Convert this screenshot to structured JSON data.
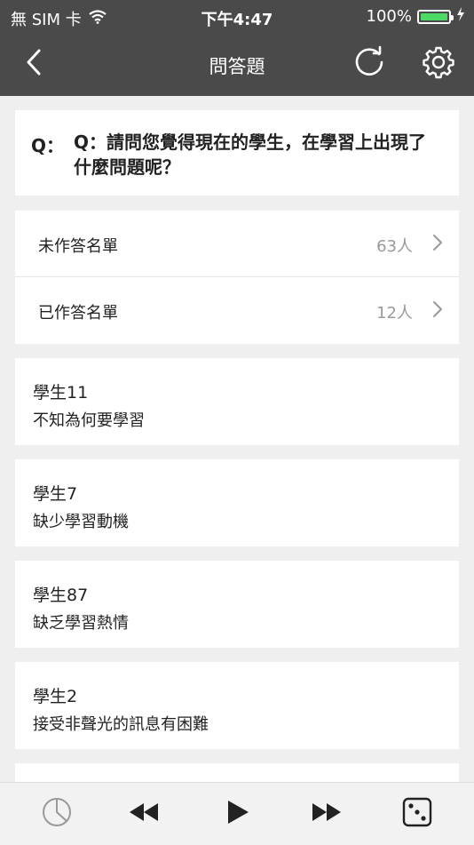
{
  "status": {
    "carrier": "無 SIM 卡",
    "time": "下午4:47",
    "battery": "100%"
  },
  "nav": {
    "title": "問答題",
    "back_icon": "chevron-left-icon",
    "refresh_icon": "refresh-icon",
    "settings_icon": "gear-icon"
  },
  "question": {
    "label": "Q：",
    "text": "Q：請問您覺得現在的學生，在學習上出現了什麼問題呢？"
  },
  "lists": [
    {
      "label": "未作答名單",
      "count": "63人"
    },
    {
      "label": "已作答名單",
      "count": "12人"
    }
  ],
  "answers": [
    {
      "name": "學生11",
      "text": "不知為何要學習"
    },
    {
      "name": "學生7",
      "text": "缺少學習動機"
    },
    {
      "name": "學生87",
      "text": "缺乏學習熱情"
    },
    {
      "name": "學生2",
      "text": "接受非聲光的訊息有困難"
    }
  ],
  "toolbar": {
    "icons": [
      "pie-chart-icon",
      "rewind-icon",
      "play-icon",
      "fast-forward-icon",
      "dice-icon"
    ]
  },
  "colors": {
    "bar": "#4a4a4a",
    "battery": "#4cd964",
    "background": "#efefef"
  }
}
